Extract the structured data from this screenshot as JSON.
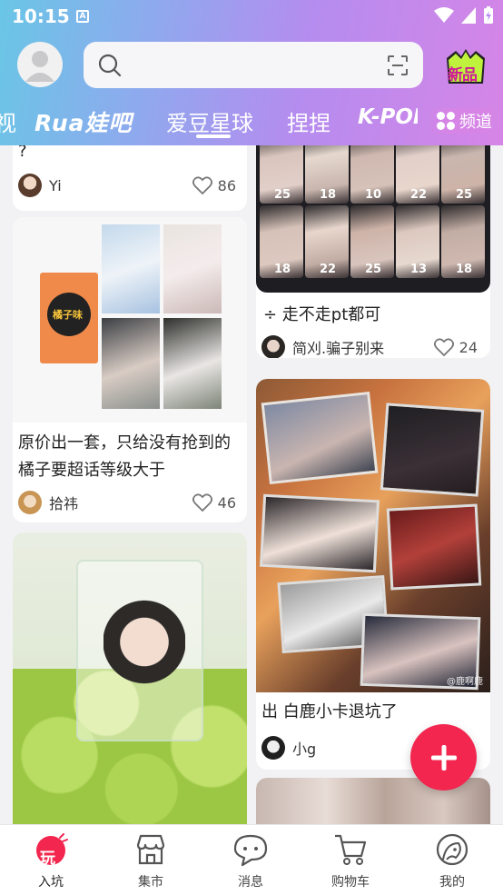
{
  "status_bar": {
    "time": "10:15",
    "app_badge": "A"
  },
  "header": {
    "search_placeholder": "",
    "new_badge_label": "新品",
    "tabs": [
      "视",
      "Rua娃吧",
      "爱豆星球",
      "捏捏",
      "K-POP"
    ],
    "active_tab": 2,
    "channel_label": "频道"
  },
  "feed": {
    "left": [
      {
        "title": "?",
        "user": "Yi",
        "likes": "86"
      },
      {
        "title": "原价出一套，只给没有抢到的橘子要超话等级大于",
        "user": "拾祎",
        "likes": "46",
        "album_text": "橘子味"
      }
    ],
    "right": [
      {
        "title": "÷   走不走pt都可",
        "user": "简刈.骗子别来",
        "likes": "24",
        "card_numbers": [
          "25",
          "18",
          "10",
          "22",
          "25",
          "18",
          "22",
          "25",
          "13",
          "18"
        ]
      },
      {
        "title": "出 白鹿小卡退坑了",
        "user": "小g",
        "watermark": "@鹿啊鹿"
      }
    ]
  },
  "fab": {
    "icon": "plus-icon"
  },
  "bottom_nav": [
    {
      "label": "入坑",
      "icon": "play-badge-icon",
      "active": true,
      "badge_text": "玩"
    },
    {
      "label": "集市",
      "icon": "store-icon",
      "active": false
    },
    {
      "label": "消息",
      "icon": "chat-bubble-icon",
      "active": false
    },
    {
      "label": "购物车",
      "icon": "cart-icon",
      "active": false
    },
    {
      "label": "我的",
      "icon": "profile-icon",
      "active": false
    }
  ],
  "colors": {
    "accent": "#f2264e",
    "header_start": "#69c6e6",
    "header_end": "#d685e6"
  }
}
